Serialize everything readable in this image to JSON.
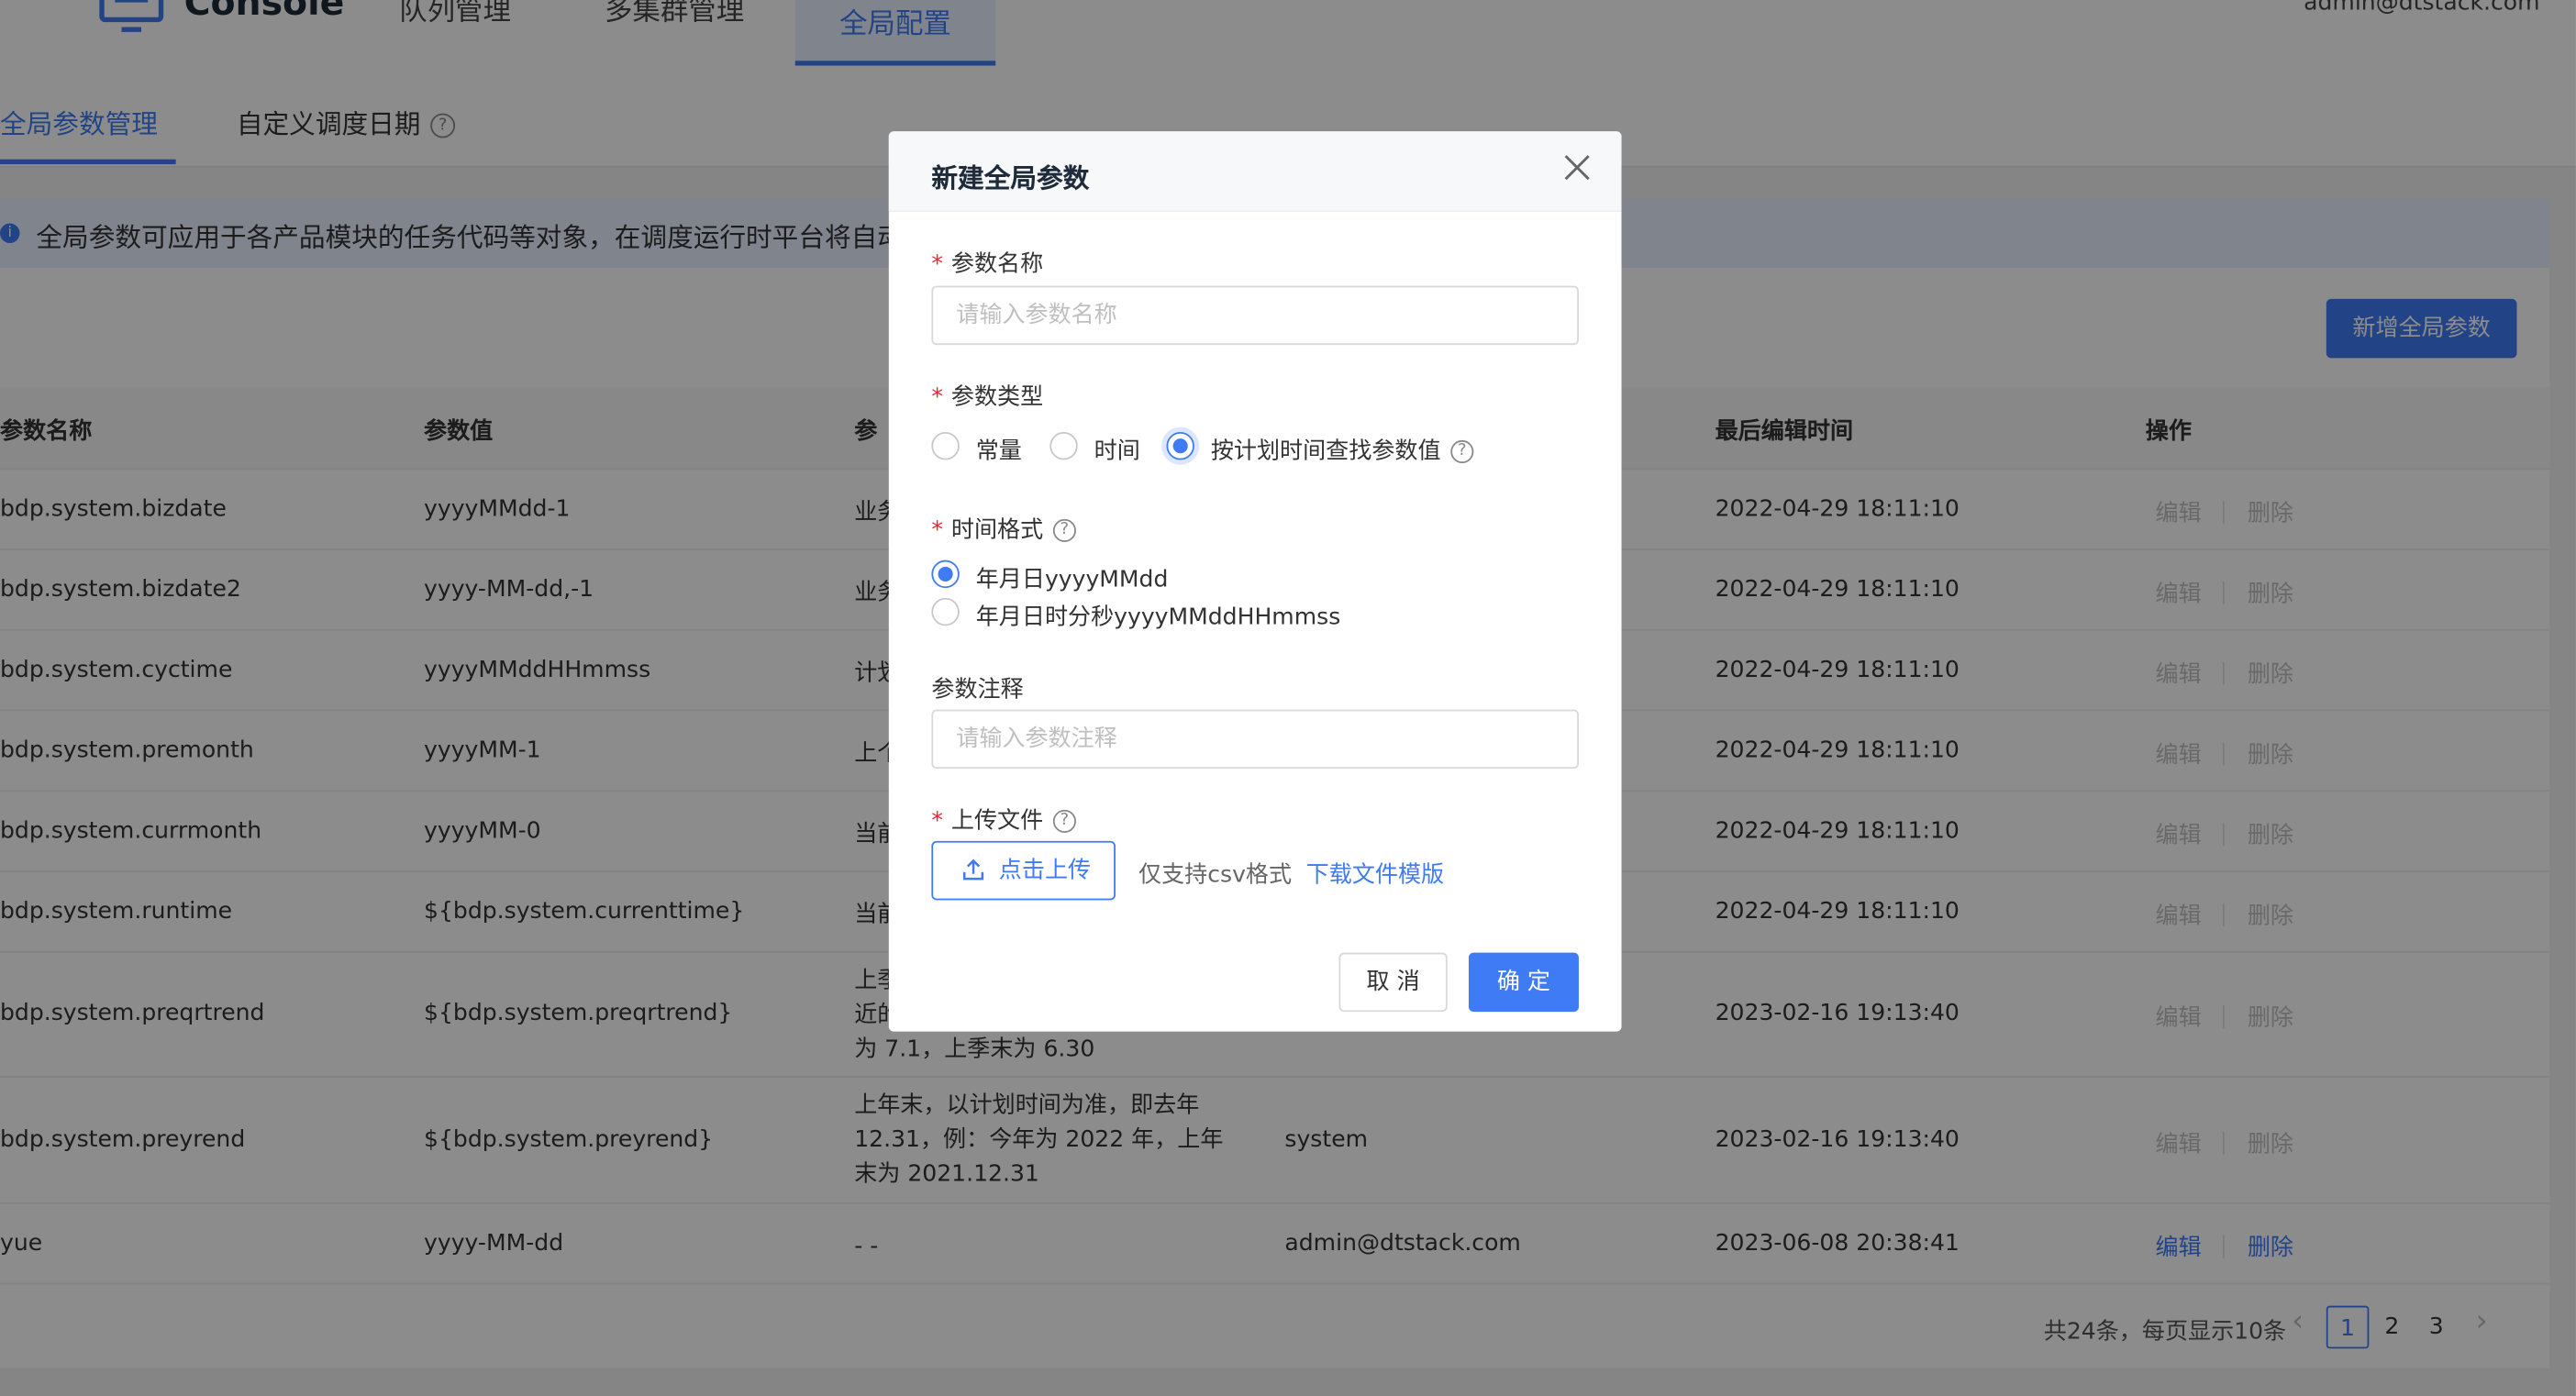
{
  "header": {
    "app_name": "Console",
    "nav": [
      "队列管理",
      "多集群管理",
      "全局配置"
    ],
    "user": "admin@dtstack.com"
  },
  "tabs": {
    "global_params": "全局参数管理",
    "custom_date": "自定义调度日期"
  },
  "info_text": "全局参数可应用于各产品模块的任务代码等对象，在调度运行时平台将自动",
  "add_button": "新增全局参数",
  "table": {
    "headers": [
      "参数名称",
      "参数值",
      "参",
      "最后编辑时间",
      "操作"
    ],
    "rows": [
      {
        "name": "bdp.system.bizdate",
        "value": "yyyyMMdd-1",
        "desc": "业务",
        "editor": "",
        "time": "2022-04-29 18:11:10"
      },
      {
        "name": "bdp.system.bizdate2",
        "value": "yyyy-MM-dd,-1",
        "desc": "业务",
        "editor": "",
        "time": "2022-04-29 18:11:10"
      },
      {
        "name": "bdp.system.cyctime",
        "value": "yyyyMMddHHmmss",
        "desc": "计划",
        "editor": "",
        "time": "2022-04-29 18:11:10"
      },
      {
        "name": "bdp.system.premonth",
        "value": "yyyyMM-1",
        "desc": "上个",
        "editor": "",
        "time": "2022-04-29 18:11:10"
      },
      {
        "name": "bdp.system.currmonth",
        "value": "yyyyMM-0",
        "desc": "当前",
        "editor": "",
        "time": "2022-04-29 18:11:10"
      },
      {
        "name": "bdp.system.runtime",
        "value": "${bdp.system.currenttime}",
        "desc": "当前",
        "editor": "",
        "time": "2022-04-29 18:11:10"
      },
      {
        "name": "bdp.system.preqrtrend",
        "value": "${bdp.system.preqrtrend}",
        "desc": "上季\n近的\n为 7.1，上季末为 6.30",
        "editor": "",
        "time": "2023-02-16 19:13:40"
      },
      {
        "name": "bdp.system.preyrend",
        "value": "${bdp.system.preyrend}",
        "desc": "上年末，以计划时间为准，即去年 12.31，例：今年为 2022 年，上年末为 2021.12.31",
        "editor": "system",
        "time": "2023-02-16 19:13:40"
      },
      {
        "name": "yue",
        "value": "yyyy-MM-dd",
        "desc": "- -",
        "editor": "admin@dtstack.com",
        "time": "2023-06-08 20:38:41"
      }
    ],
    "op_edit": "编辑",
    "op_delete": "删除"
  },
  "pagination": {
    "total_text": "共24条，每页显示10条",
    "pages": [
      "1",
      "2",
      "3"
    ],
    "current": "1"
  },
  "modal": {
    "title": "新建全局参数",
    "name_label": "参数名称",
    "name_placeholder": "请输入参数名称",
    "type_label": "参数类型",
    "type_options": [
      "常量",
      "时间",
      "按计划时间查找参数值"
    ],
    "type_selected": "按计划时间查找参数值",
    "format_label": "时间格式",
    "format_options": [
      "年月日yyyyMMdd",
      "年月日时分秒yyyyMMddHHmmss"
    ],
    "format_selected": "年月日yyyyMMdd",
    "comment_label": "参数注释",
    "comment_placeholder": "请输入参数注释",
    "upload_label": "上传文件",
    "upload_button": "点击上传",
    "upload_hint": "仅支持csv格式",
    "download_link": "下载文件模版",
    "cancel": "取 消",
    "ok": "确 定"
  },
  "colors": {
    "primary": "#3f7bf5",
    "required": "#f5222d"
  }
}
